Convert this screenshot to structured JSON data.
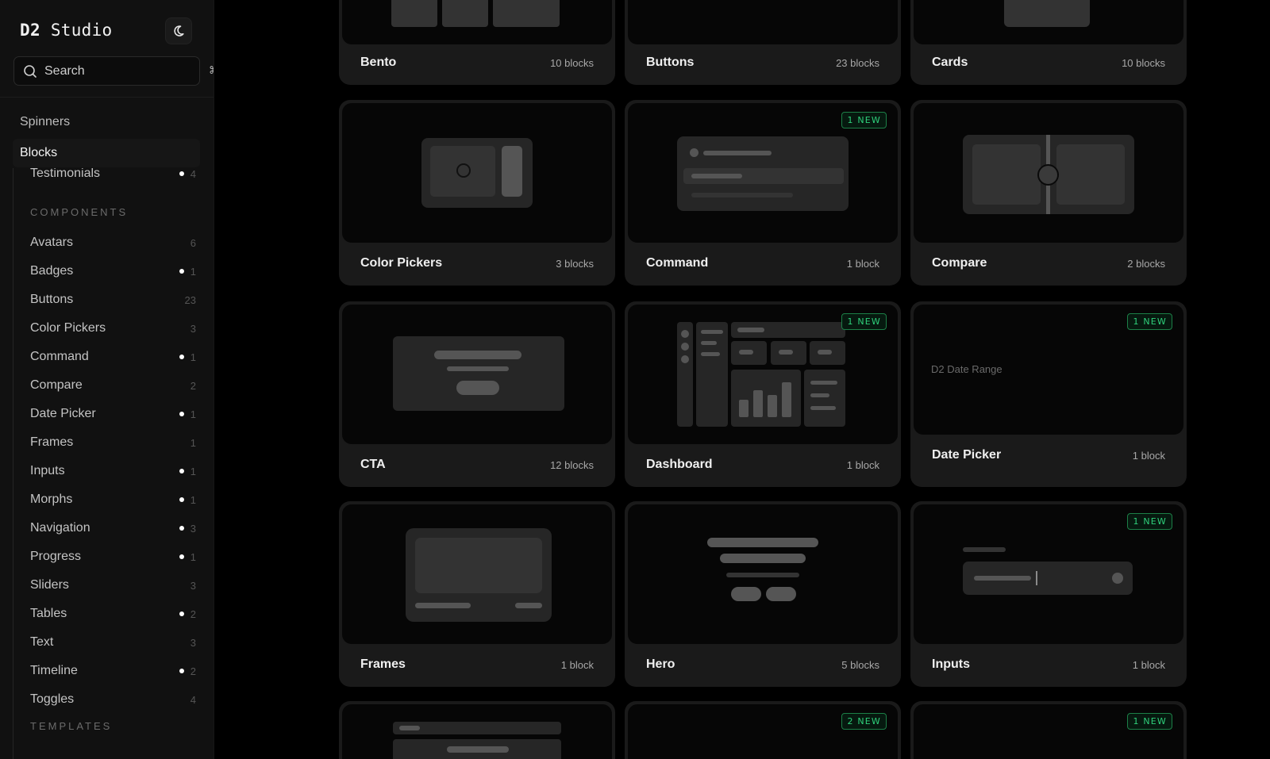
{
  "brand": {
    "prefix": "D2",
    "name": "Studio"
  },
  "search": {
    "placeholder": "Search",
    "shortcut": "⌘K"
  },
  "nav": {
    "top_items": [
      "Spinners",
      "Blocks"
    ],
    "truncated_item": {
      "label": "Testimonials",
      "count": "4",
      "new": true
    },
    "sections": [
      {
        "header": "COMPONENTS",
        "items": [
          {
            "label": "Avatars",
            "count": "6",
            "new": false
          },
          {
            "label": "Badges",
            "count": "1",
            "new": true
          },
          {
            "label": "Buttons",
            "count": "23",
            "new": false
          },
          {
            "label": "Color Pickers",
            "count": "3",
            "new": false
          },
          {
            "label": "Command",
            "count": "1",
            "new": true
          },
          {
            "label": "Compare",
            "count": "2",
            "new": false
          },
          {
            "label": "Date Picker",
            "count": "1",
            "new": true
          },
          {
            "label": "Frames",
            "count": "1",
            "new": false
          },
          {
            "label": "Inputs",
            "count": "1",
            "new": true
          },
          {
            "label": "Morphs",
            "count": "1",
            "new": true
          },
          {
            "label": "Navigation",
            "count": "3",
            "new": true
          },
          {
            "label": "Progress",
            "count": "1",
            "new": true
          },
          {
            "label": "Sliders",
            "count": "3",
            "new": false
          },
          {
            "label": "Tables",
            "count": "2",
            "new": true
          },
          {
            "label": "Text",
            "count": "3",
            "new": false
          },
          {
            "label": "Timeline",
            "count": "2",
            "new": true
          },
          {
            "label": "Toggles",
            "count": "4",
            "new": false
          }
        ]
      },
      {
        "header": "TEMPLATES",
        "items": []
      }
    ]
  },
  "cards": [
    {
      "title": "Bento",
      "count": "10 blocks",
      "badge": "",
      "preview": "bento"
    },
    {
      "title": "Buttons",
      "count": "23 blocks",
      "badge": "",
      "preview": "buttons"
    },
    {
      "title": "Cards",
      "count": "10 blocks",
      "badge": "",
      "preview": "cards"
    },
    {
      "title": "Color Pickers",
      "count": "3 blocks",
      "badge": "",
      "preview": "color-pickers"
    },
    {
      "title": "Command",
      "count": "1 block",
      "badge": "1 NEW",
      "preview": "command"
    },
    {
      "title": "Compare",
      "count": "2 blocks",
      "badge": "",
      "preview": "compare"
    },
    {
      "title": "CTA",
      "count": "12 blocks",
      "badge": "",
      "preview": "cta"
    },
    {
      "title": "Dashboard",
      "count": "1 block",
      "badge": "1 NEW",
      "preview": "dashboard"
    },
    {
      "title": "Date Picker",
      "count": "1 block",
      "badge": "1 NEW",
      "preview": "date-picker",
      "preview_text": "D2 Date Range"
    },
    {
      "title": "Frames",
      "count": "1 block",
      "badge": "",
      "preview": "frames"
    },
    {
      "title": "Hero",
      "count": "5 blocks",
      "badge": "",
      "preview": "hero"
    },
    {
      "title": "Inputs",
      "count": "1 block",
      "badge": "1 NEW",
      "preview": "inputs"
    },
    {
      "title": "",
      "count": "",
      "badge": "",
      "preview": "partial-a"
    },
    {
      "title": "",
      "count": "",
      "badge": "2 NEW",
      "preview": "partial-b"
    },
    {
      "title": "",
      "count": "",
      "badge": "1 NEW",
      "preview": "partial-c"
    }
  ],
  "colors": {
    "background": "#000000",
    "sidebar": "#111111",
    "card": "#1a1a1a",
    "thumb": "#060606",
    "new_badge": "#2fd07b"
  }
}
